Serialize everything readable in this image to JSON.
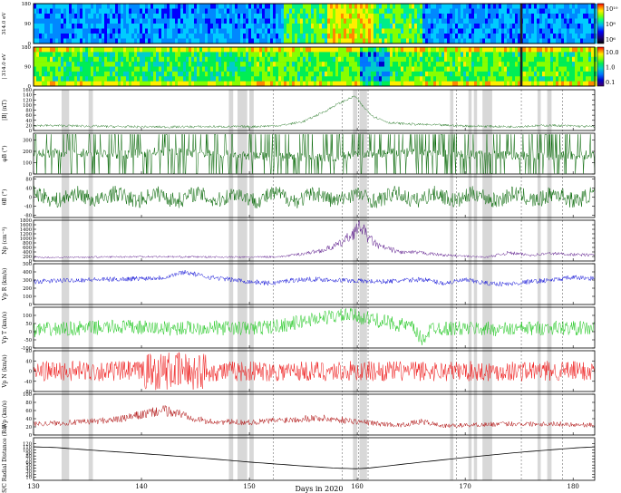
{
  "chart_data": {
    "type": "line",
    "xlabel": "Days in 2020",
    "xlim": [
      130,
      182
    ],
    "x_ticks": [
      130,
      140,
      150,
      160,
      170,
      180
    ],
    "shaded_intervals": [
      [
        132.6,
        133.3
      ],
      [
        135.1,
        135.5
      ],
      [
        148.1,
        148.5
      ],
      [
        148.9,
        149.8
      ],
      [
        150.0,
        150.4
      ],
      [
        159.6,
        160.0
      ],
      [
        160.2,
        160.9
      ],
      [
        168.6,
        168.9
      ],
      [
        170.3,
        170.6
      ],
      [
        170.8,
        171.1
      ],
      [
        171.6,
        172.5
      ],
      [
        176.7,
        177.0
      ],
      [
        177.6,
        178.0
      ]
    ],
    "dashed_lines": [
      152.2,
      158.6,
      160.1,
      161.0,
      169.2,
      175.2,
      179.0
    ],
    "heatmaps": [
      {
        "name": "pad-1",
        "ylabel": "314.0 eV",
        "ylim": [
          0,
          180
        ],
        "y_ticks": [
          0,
          90,
          180
        ],
        "colorbar_ticks": [
          "10¹⁰",
          "10⁸",
          "10⁶"
        ],
        "colors": [
          "#000088",
          "#0000ff",
          "#0088ff",
          "#00ccff",
          "#00ee88",
          "#88ff00",
          "#ffee00",
          "#ff8800",
          "#ff0000"
        ]
      },
      {
        "name": "pad-2",
        "ylabel": "| 314.0 eV",
        "ylim": [
          0,
          180
        ],
        "y_ticks": [
          0,
          90,
          180
        ],
        "colorbar_ticks": [
          "10.0",
          "1.0",
          "0.1"
        ],
        "colors": [
          "#440066",
          "#0000cc",
          "#0077ff",
          "#00cccc",
          "#00ee55",
          "#88ff00",
          "#ffee00",
          "#ff8800",
          "#ff0000"
        ]
      }
    ],
    "panels": [
      {
        "name": "B",
        "ylabel": "|B| (nT)",
        "ylim": [
          0,
          160
        ],
        "y_ticks": [
          0,
          20,
          40,
          60,
          80,
          100,
          120,
          140,
          160
        ],
        "color": "#2d7d2d",
        "x": [
          130,
          134,
          138,
          142,
          146,
          150,
          153,
          155,
          156,
          157,
          158,
          159,
          159.8,
          160.5,
          161.5,
          163,
          165,
          167,
          170,
          174,
          178,
          182
        ],
        "y": [
          20,
          18,
          15,
          14,
          15,
          15,
          20,
          35,
          55,
          75,
          100,
          120,
          135,
          95,
          55,
          30,
          25,
          22,
          18,
          15,
          20,
          15
        ]
      },
      {
        "name": "phiB",
        "ylabel": "φB (°)",
        "ylim": [
          0,
          360
        ],
        "y_ticks": [
          0,
          100,
          200,
          300
        ],
        "color": "#006400",
        "x": [
          130,
          134,
          138,
          142,
          146,
          150,
          154,
          158,
          160,
          164,
          168,
          172,
          176,
          180,
          182
        ],
        "y": [
          180,
          190,
          170,
          200,
          180,
          160,
          150,
          145,
          170,
          190,
          180,
          170,
          160,
          165,
          170
        ]
      },
      {
        "name": "thetaB",
        "ylabel": "θB (°)",
        "ylim": [
          -90,
          90
        ],
        "y_ticks": [
          -80,
          -40,
          0,
          40,
          80
        ],
        "color": "#006400",
        "x": [
          130,
          182
        ],
        "y": [
          0,
          0
        ]
      },
      {
        "name": "Np",
        "ylabel": "Np (cm⁻³)",
        "ylim": [
          0,
          1800
        ],
        "y_ticks": [
          0,
          200,
          400,
          600,
          800,
          1000,
          1200,
          1400,
          1600,
          1800
        ],
        "color": "#5c1a8c",
        "x": [
          130,
          135,
          140,
          145,
          150,
          153,
          155,
          157,
          158.5,
          159.5,
          160.3,
          161,
          162,
          164,
          166,
          168,
          170,
          172,
          174,
          176,
          178,
          180,
          182
        ],
        "y": [
          120,
          130,
          150,
          140,
          130,
          150,
          250,
          380,
          600,
          900,
          1200,
          800,
          500,
          300,
          280,
          200,
          160,
          130,
          280,
          200,
          260,
          220,
          200
        ]
      },
      {
        "name": "VpR",
        "ylabel": "Vp R (km/s)",
        "ylim": [
          0,
          500
        ],
        "y_ticks": [
          0,
          100,
          200,
          300,
          400,
          500
        ],
        "color": "#1515d8",
        "x": [
          130,
          134,
          138,
          142,
          144,
          146,
          150,
          152,
          154,
          156,
          158,
          160,
          162,
          164,
          166,
          168,
          170,
          172,
          174,
          176,
          178,
          180,
          182
        ],
        "y": [
          280,
          300,
          310,
          330,
          400,
          340,
          280,
          260,
          300,
          310,
          300,
          290,
          280,
          290,
          310,
          260,
          300,
          260,
          250,
          280,
          300,
          330,
          320
        ]
      },
      {
        "name": "VpT",
        "ylabel": "Vp T (km/s)",
        "ylim": [
          -100,
          150
        ],
        "y_ticks": [
          -100,
          -50,
          0,
          50,
          100
        ],
        "color": "#22c822",
        "x": [
          130,
          134,
          138,
          142,
          146,
          150,
          152,
          154,
          156,
          158,
          159.5,
          161,
          163,
          165,
          166,
          167,
          168,
          170,
          174,
          178,
          182
        ],
        "y": [
          10,
          20,
          30,
          20,
          25,
          20,
          30,
          50,
          80,
          95,
          100,
          80,
          55,
          30,
          -50,
          30,
          20,
          20,
          15,
          25,
          20
        ]
      },
      {
        "name": "VpN",
        "ylabel": "Vp N (km/s)",
        "ylim": [
          -80,
          80
        ],
        "y_ticks": [
          -80,
          -40,
          0,
          40,
          80
        ],
        "color": "#ee1111",
        "x": [
          130,
          182
        ],
        "y": [
          0,
          0
        ]
      },
      {
        "name": "Wp",
        "ylabel": "Wp (km/s)",
        "ylim": [
          0,
          100
        ],
        "y_ticks": [
          0,
          20,
          40,
          60,
          80,
          100
        ],
        "color": "#b01010",
        "x": [
          130,
          134,
          138,
          140,
          142,
          144,
          146,
          150,
          154,
          156,
          158,
          160,
          162,
          164,
          166,
          168,
          170,
          174,
          178,
          182
        ],
        "y": [
          25,
          28,
          35,
          45,
          55,
          45,
          30,
          28,
          35,
          38,
          35,
          30,
          25,
          22,
          30,
          20,
          22,
          25,
          25,
          22
        ]
      },
      {
        "name": "R",
        "ylabel": "S/C Radial Distance (Rs)",
        "ylim": [
          0,
          140
        ],
        "y_ticks": [
          10,
          20,
          30,
          40,
          50,
          60,
          70,
          80,
          90,
          100,
          110,
          120
        ],
        "color": "#000000",
        "x": [
          130,
          132,
          135,
          140,
          145,
          150,
          155,
          158,
          160,
          161,
          163,
          166,
          170,
          175,
          180,
          182
        ],
        "y": [
          110,
          108,
          100,
          88,
          75,
          60,
          47,
          40,
          38,
          40,
          48,
          60,
          75,
          92,
          106,
          110
        ]
      }
    ]
  }
}
